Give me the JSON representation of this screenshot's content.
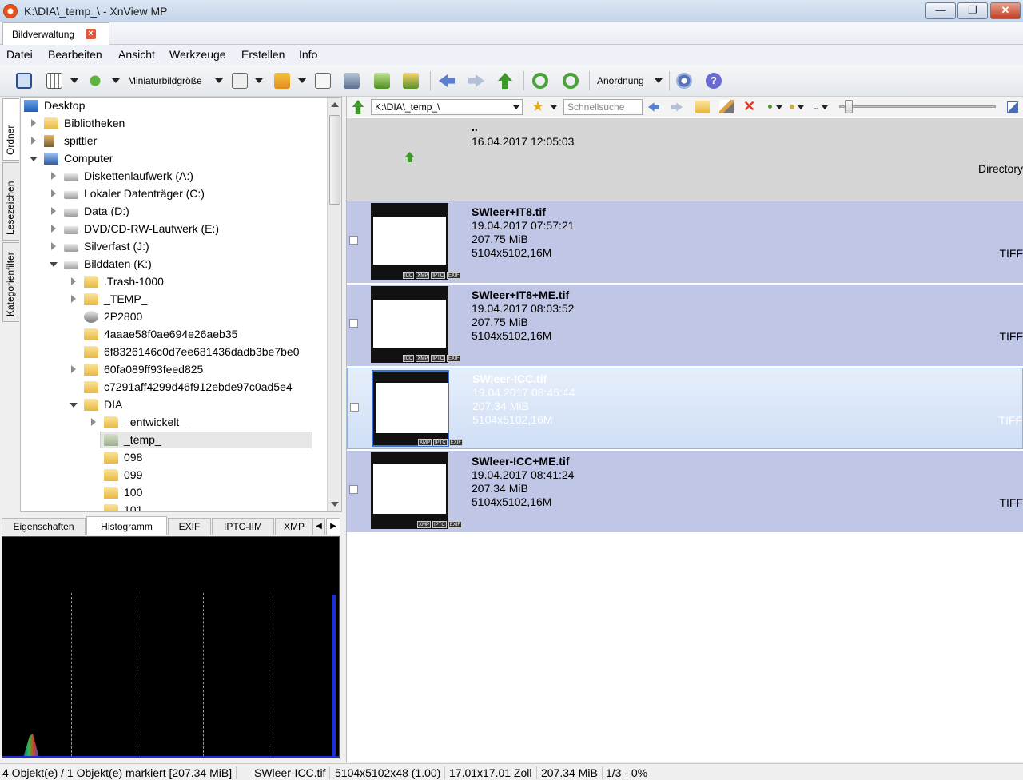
{
  "window": {
    "title": "K:\\DIA\\_temp_\\ - XnView MP",
    "min": "—",
    "max": "❐",
    "close": "✕"
  },
  "tab": {
    "label": "Bildverwaltung",
    "close": "×"
  },
  "menu": [
    "Datei",
    "Bearbeiten",
    "Ansicht",
    "Werkzeuge",
    "Erstellen",
    "Info"
  ],
  "toolbar": {
    "thumb_size_label": "Miniaturbildgröße",
    "arrange_label": "Anordnung"
  },
  "sidetabs": [
    "Ordner",
    "Lesezeichen",
    "Kategorienfilter"
  ],
  "tree": [
    {
      "label": "Desktop",
      "icon": "desktop-icon"
    },
    {
      "label": "Bibliotheken",
      "icon": "libraries-icon"
    },
    {
      "label": "spittler",
      "icon": "user-icon"
    },
    {
      "label": "Computer",
      "icon": "computer-icon"
    },
    {
      "label": "Diskettenlaufwerk (A:)",
      "icon": "floppy-icon"
    },
    {
      "label": "Lokaler Datenträger (C:)",
      "icon": "drive-icon"
    },
    {
      "label": "Data (D:)",
      "icon": "drive-icon"
    },
    {
      "label": "DVD/CD-RW-Laufwerk (E:)",
      "icon": "dvd-icon"
    },
    {
      "label": "Silverfast (J:)",
      "icon": "drive-icon"
    },
    {
      "label": "Bilddaten (K:)",
      "icon": "drive-icon"
    },
    {
      "label": ".Trash-1000",
      "icon": "folder-icon"
    },
    {
      "label": "_TEMP_",
      "icon": "folder-icon"
    },
    {
      "label": "2P2800",
      "icon": "network-folder-icon"
    },
    {
      "label": "4aaae58f0ae694e26aeb35",
      "icon": "folder-icon"
    },
    {
      "label": "6f8326146c0d7ee681436dadb3be7be0",
      "icon": "folder-icon"
    },
    {
      "label": "60fa089ff93feed825",
      "icon": "folder-icon"
    },
    {
      "label": "c7291aff4299d46f912ebde97c0ad5e4",
      "icon": "folder-icon"
    },
    {
      "label": "DIA",
      "icon": "folder-icon"
    },
    {
      "label": "_entwickelt_",
      "icon": "folder-icon"
    },
    {
      "label": "_temp_",
      "icon": "folder-icon"
    },
    {
      "label": "098",
      "icon": "folder-icon"
    },
    {
      "label": "099",
      "icon": "folder-icon"
    },
    {
      "label": "100",
      "icon": "folder-icon"
    },
    {
      "label": "101",
      "icon": "folder-icon"
    }
  ],
  "info_tabs": [
    "Eigenschaften",
    "Histogramm",
    "EXIF",
    "IPTC-IIM",
    "XMP"
  ],
  "address": {
    "path": "K:\\DIA\\_temp_\\",
    "search_placeholder": "Schnellsuche"
  },
  "parent": {
    "name": "..",
    "date": "16.04.2017 12:05:03",
    "type": "Directory"
  },
  "files": [
    {
      "name": "SWleer+IT8.tif",
      "date": "19.04.2017 07:57:21",
      "size": "207.75 MiB",
      "dims": "5104x5102,16M",
      "type": "TIFF",
      "badges": [
        "ICC",
        "XMP",
        "IPTC",
        "EXIF"
      ]
    },
    {
      "name": "SWleer+IT8+ME.tif",
      "date": "19.04.2017 08:03:52",
      "size": "207.75 MiB",
      "dims": "5104x5102,16M",
      "type": "TIFF",
      "badges": [
        "ICC",
        "XMP",
        "IPTC",
        "EXIF"
      ]
    },
    {
      "name": "SWleer-ICC.tif",
      "date": "19.04.2017 08:45:44",
      "size": "207.34 MiB",
      "dims": "5104x5102,16M",
      "type": "TIFF",
      "badges": [
        "XMP",
        "IPTC",
        "EXIF"
      ]
    },
    {
      "name": "SWleer-ICC+ME.tif",
      "date": "19.04.2017 08:41:24",
      "size": "207.34 MiB",
      "dims": "5104x5102,16M",
      "type": "TIFF",
      "badges": [
        "XMP",
        "IPTC",
        "EXIF"
      ]
    }
  ],
  "status": [
    "4 Objekt(e) / 1 Objekt(e) markiert [207.34 MiB]",
    "SWleer-ICC.tif",
    "5104x5102x48 (1.00)",
    "17.01x17.01 Zoll",
    "207.34 MiB",
    "1/3 - 0%"
  ],
  "colors": {
    "row_bg": "#c0c6e6",
    "row_selected_bg": "#d9e6f9",
    "parent_bg": "#d6d6d6"
  }
}
